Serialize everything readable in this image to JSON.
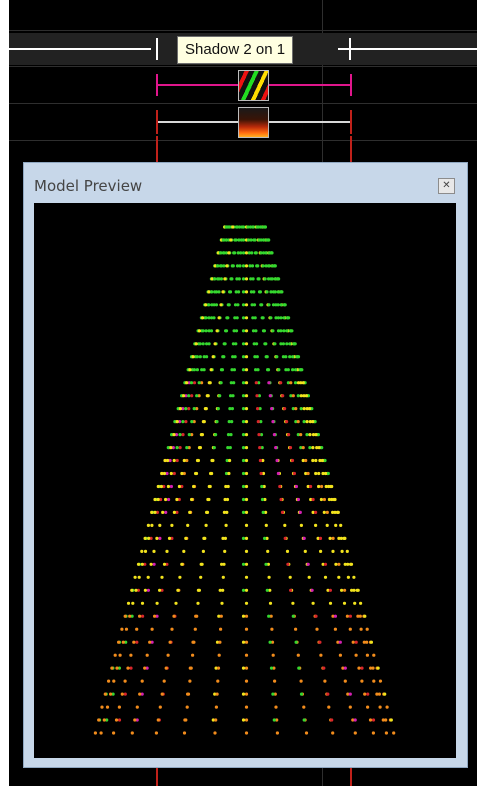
{
  "timeline": {
    "effect_tooltip": "Shadow 2 on 1",
    "effects": [
      {
        "name": "colorwash",
        "icon": "stripes-effect-icon",
        "color": "#e0168c"
      },
      {
        "name": "fire",
        "icon": "fire-effect-icon",
        "color": "#d8d8d8"
      }
    ],
    "marker_color": "#c0211a"
  },
  "preview": {
    "title": "Model Preview",
    "close_icon": "close-icon",
    "colors": {
      "green": "#35d72f",
      "yellow": "#f2e31d",
      "orange": "#f28c1c",
      "red": "#d8262b",
      "magenta": "#d51fb3"
    }
  }
}
